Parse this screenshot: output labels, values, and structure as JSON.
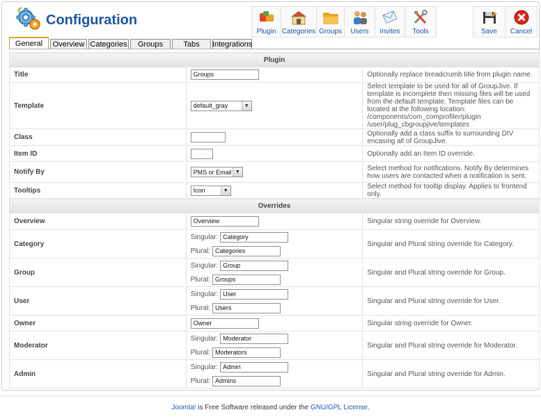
{
  "header": {
    "title": "Configuration",
    "toolbar": [
      {
        "label": "Plugin",
        "icon": "plugin-icon"
      },
      {
        "label": "Categories",
        "icon": "categories-icon"
      },
      {
        "label": "Groups",
        "icon": "groups-icon"
      },
      {
        "label": "Users",
        "icon": "users-icon"
      },
      {
        "label": "Invites",
        "icon": "invites-icon"
      },
      {
        "label": "Tools",
        "icon": "tools-icon"
      }
    ],
    "actions": [
      {
        "label": "Save",
        "icon": "save-icon"
      },
      {
        "label": "Cancel",
        "icon": "cancel-icon"
      }
    ]
  },
  "tabs": [
    "General",
    "Overview",
    "Categories",
    "Groups",
    "Tabs",
    "Integrations"
  ],
  "active_tab": "General",
  "sections": {
    "plugin": "Plugin",
    "overrides": "Overrides"
  },
  "plugin_rows": {
    "title": {
      "label": "Title",
      "value": "Groups",
      "desc": "Optionally replace breadcrumb title from plugin name."
    },
    "template": {
      "label": "Template",
      "value": "default_gray",
      "desc": "Select template to be used for all of GroupJive. If template is incomplete then missing files will be used from the default template. Template files can be located at the following location: /components/com_comprofiler/plugin /user/plug_cbgroupjive/templates"
    },
    "class": {
      "label": "Class",
      "value": "",
      "desc": "Optionally add a class suffix to surrounding DIV encasing all of GroupJive."
    },
    "item_id": {
      "label": "Item ID",
      "value": "",
      "desc": "Optionally add an Item ID override."
    },
    "notify_by": {
      "label": "Notify By",
      "value": "PMS or Email",
      "desc": "Select method for notifications. Notify By determines how users are contacted when a notification is sent."
    },
    "tooltips": {
      "label": "Tooltips",
      "value": "Icon",
      "desc": "Select method for tooltip display. Applies to frontend only."
    }
  },
  "override_rows": {
    "overview": {
      "label": "Overview",
      "value": "Overview",
      "desc": "Singular string override for Overview."
    },
    "category": {
      "label": "Category",
      "singular_label": "Singular:",
      "singular": "Category",
      "plural_label": "Plural:",
      "plural": "Categories",
      "desc": "Singular and Plural string override for Category."
    },
    "group": {
      "label": "Group",
      "singular_label": "Singular:",
      "singular": "Group",
      "plural_label": "Plural:",
      "plural": "Groups",
      "desc": "Singular and Plural string override for Group."
    },
    "user": {
      "label": "User",
      "singular_label": "Singular:",
      "singular": "User",
      "plural_label": "Plural:",
      "plural": "Users",
      "desc": "Singular and Plural string override for User."
    },
    "owner": {
      "label": "Owner",
      "value": "Owner",
      "desc": "Singular string override for Owner."
    },
    "moderator": {
      "label": "Moderator",
      "singular_label": "Singular:",
      "singular": "Moderator",
      "plural_label": "Plural:",
      "plural": "Moderators",
      "desc": "Singular and Plural string override for Moderator."
    },
    "admin": {
      "label": "Admin",
      "singular_label": "Singular:",
      "singular": "Admin",
      "plural_label": "Plural:",
      "plural": "Admins",
      "desc": "Singular and Plural string override for Admin."
    }
  },
  "footer": {
    "link1": "Joomla!",
    "text1": " is Free Software released under the ",
    "link2": "GNU/GPL License",
    "text2": "."
  },
  "colors": {
    "accent": "#1d56a3",
    "tab_active": "#d9a12a"
  }
}
